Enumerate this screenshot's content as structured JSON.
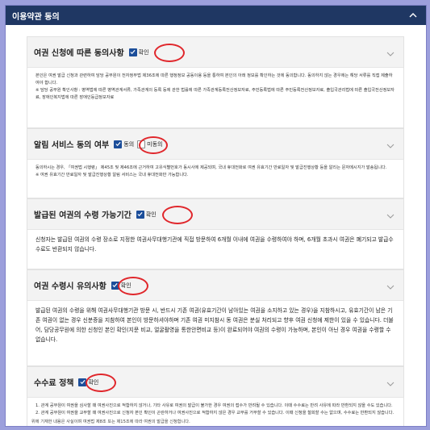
{
  "header": {
    "title": "이용약관 동의"
  },
  "colors": {
    "header_bg": "#1f3763",
    "accent": "#1c4e9a",
    "highlight": "#e0262b"
  },
  "sections": [
    {
      "title": "여권 신청에 따른 동의사항",
      "check_label": "확인",
      "body": [
        "본인은 여권 발급 신청과 관련하여 담당 공무원이 전자정부법 제36조에 따른 행정정보 공동이용 등을 통하여 본인의 아래 정보를 확인하는 것에 동의합니다. 동의하지 않는 경우에는 해당 서류를 직접 제출하여야 합니다.",
        "※ 담당 공무원 확인사항 : 병역법에 따른 병역관계서류, 가족관계의 등록 등에 관한 법률에 따른 가족관계등록전산정보자료, 주민등록법에 따른 주민등록전산정보자료, 출입국관리법에 따른 출입국전산정보자료, 장애인복지법에 따른 장애인등급정보자료"
      ]
    },
    {
      "title": "알림 서비스 동의 여부",
      "check_label": "동의",
      "uncheck_label": "미동의",
      "body": [
        "동의하시는 경우, 「여권법 시행령」 제45조 및 제46조에 근거하여 고유식별번호가 동시사에 제공되며, 국내 휴대전화로 여권 유효기간 만료일자 및 발급진행상황 등을 알리는 문자메시지가 발송됩니다.",
        "※ 여권 유효기간 만료일자 및 발급진행상황 알림 서비스는 국내 휴대전화만 가능합니다."
      ]
    },
    {
      "title": "발급된 여권의 수령 가능기간",
      "check_label": "확인",
      "body": [
        "신청자는 발급된 여권의 수령 장소로 지정한 여권사무대행기관에 직접 방문하여 6개월 이내에 여권을 수령하여야 하며, 6개월 초과시 여권은 폐기되고 발급수수료도 반환되지 않습니다."
      ]
    },
    {
      "title": "여권 수령시 유의사항",
      "check_label": "확인",
      "body": [
        "발급된 여권의 수령을 위해 여권사무대행기관 방문 시, 반드시 기존 여권(유효기간이 남아있는 여권을 소지하고 있는 경우)을 지참하시고, 유효기간이 남은 기존 여권이 없는 경우 신분증을 지참하여 본인이 방문하셔야하며 기존 여권 미지참시 동 여권은 분실 처리되고 향후 여권 신청에 제한이 있을 수 있습니다. 더불어, 담당공무원에 의한 신청인 본인 확인(지문 비교, 얼굴촬영을 통한안면비교 등)이 완료되어야 여권의 수령이 가능하며, 본인이 아닌 경우 여권을 수령할 수 없습니다."
      ]
    },
    {
      "title": "수수료 정책",
      "check_label": "확인",
      "body": [
        "1. 관계 공무원이 여권을 심사할 때 여권사진으로 적합하지 않거나, 기타 사유로 여권의 발급이 불가한 경우 여권의 접수가 반려될 수 있습니다. 이때 수수료는 반려 사유에 따라 반환되지 않을 수도 있습니다.",
        "2. 관계 공무원이 여권을 교부할 때 여권사진으로 신청자 본인 확인이 곤란하거나 여권사진으로 적합하지 않은 경우 교부를 거부할 수 있습니다. 이때 신청을 철회할 수는 없으며, 수수료는 반환되지 않습니다."
      ]
    }
  ],
  "footer": {
    "note": "위에 기재한 내용은 사실이며 여권법 제8조 또는 제15조에 따라 여권의 발급을 신청합니다."
  }
}
